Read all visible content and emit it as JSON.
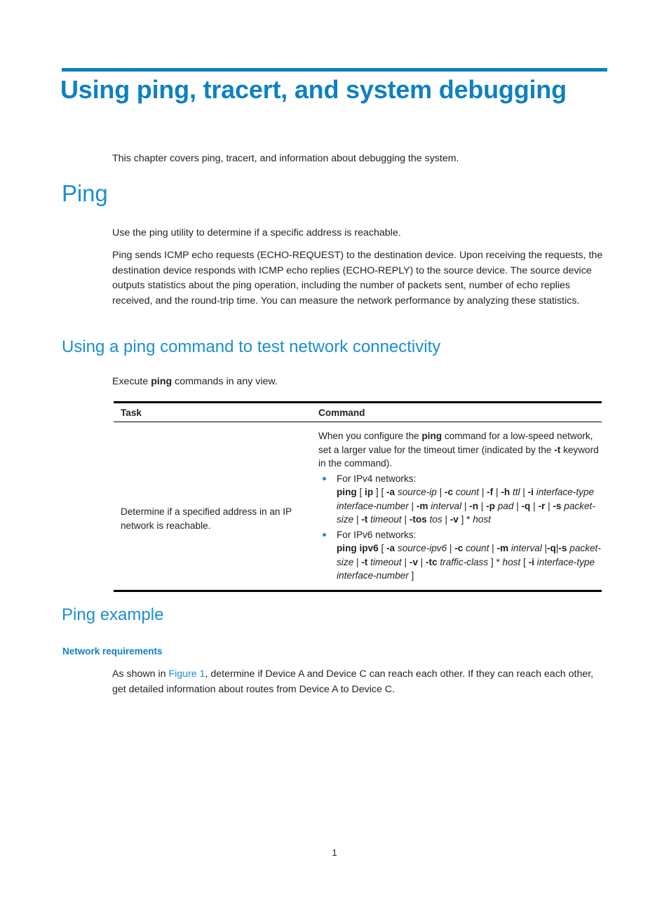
{
  "document": {
    "chapter_title": "Using ping, tracert, and system debugging",
    "intro_paragraph": "This chapter covers ping, tracert, and information about debugging the system.",
    "page_number": "1",
    "accent_color": "#0e81c0",
    "heading_color": "#1b8fcf",
    "link_color": "#1b8fcf",
    "text_color": "#231f20"
  },
  "ping_section": {
    "heading": "Ping",
    "paragraph_1": "Use the ping utility to determine if a specific address is reachable.",
    "paragraph_2": "Ping sends ICMP echo requests (ECHO-REQUEST) to the destination device. Upon receiving the requests, the destination device responds with ICMP echo replies (ECHO-REPLY) to the source device. The source device outputs statistics about the ping operation, including the number of packets sent, number of echo replies received, and the round-trip time. You can measure the network performance by analyzing these statistics."
  },
  "ping_command_section": {
    "heading": "Using a ping command to test network connectivity",
    "lead_in": {
      "prefix": "Execute ",
      "bold": "ping",
      "suffix": " commands in any view."
    },
    "table": {
      "headers": {
        "task": "Task",
        "command": "Command"
      },
      "row": {
        "task": "Determine if a specified address in an IP network is reachable.",
        "command_intro": {
          "part_1": "When you configure the ",
          "bold_1": "ping",
          "part_2": " command for a low-speed network, set a larger value for the timeout timer (indicated by the ",
          "bold_2": "-t",
          "part_3": " keyword in the command)."
        },
        "bullets": [
          {
            "label": "For IPv4 networks:",
            "syntax_tokens": [
              {
                "t": "ping",
                "s": "b"
              },
              {
                "t": " [ ",
                "s": "n"
              },
              {
                "t": "ip",
                "s": "b"
              },
              {
                "t": " ] [ ",
                "s": "n"
              },
              {
                "t": "-a",
                "s": "b"
              },
              {
                "t": " ",
                "s": "n"
              },
              {
                "t": "source-ip",
                "s": "i"
              },
              {
                "t": " | ",
                "s": "n"
              },
              {
                "t": "-c",
                "s": "b"
              },
              {
                "t": " ",
                "s": "n"
              },
              {
                "t": "count",
                "s": "i"
              },
              {
                "t": " | ",
                "s": "n"
              },
              {
                "t": "-f",
                "s": "b"
              },
              {
                "t": " | ",
                "s": "n"
              },
              {
                "t": "-h",
                "s": "b"
              },
              {
                "t": " ",
                "s": "n"
              },
              {
                "t": "ttl",
                "s": "i"
              },
              {
                "t": " | ",
                "s": "n"
              },
              {
                "t": "-i",
                "s": "b"
              },
              {
                "t": " ",
                "s": "n"
              },
              {
                "t": "interface-type interface-number",
                "s": "i"
              },
              {
                "t": " | ",
                "s": "n"
              },
              {
                "t": "-m",
                "s": "b"
              },
              {
                "t": " ",
                "s": "n"
              },
              {
                "t": "interval",
                "s": "i"
              },
              {
                "t": " | ",
                "s": "n"
              },
              {
                "t": "-n",
                "s": "b"
              },
              {
                "t": " | ",
                "s": "n"
              },
              {
                "t": "-p",
                "s": "b"
              },
              {
                "t": " ",
                "s": "n"
              },
              {
                "t": "pad",
                "s": "i"
              },
              {
                "t": " | ",
                "s": "n"
              },
              {
                "t": "-q",
                "s": "b"
              },
              {
                "t": " | ",
                "s": "n"
              },
              {
                "t": "-r",
                "s": "b"
              },
              {
                "t": " | ",
                "s": "n"
              },
              {
                "t": "-s",
                "s": "b"
              },
              {
                "t": " ",
                "s": "n"
              },
              {
                "t": "packet-size",
                "s": "i"
              },
              {
                "t": " | ",
                "s": "n"
              },
              {
                "t": "-t",
                "s": "b"
              },
              {
                "t": " ",
                "s": "n"
              },
              {
                "t": "timeout",
                "s": "i"
              },
              {
                "t": " | ",
                "s": "n"
              },
              {
                "t": "-tos",
                "s": "b"
              },
              {
                "t": " ",
                "s": "n"
              },
              {
                "t": "tos",
                "s": "i"
              },
              {
                "t": " | ",
                "s": "n"
              },
              {
                "t": "-v",
                "s": "b"
              },
              {
                "t": " ] * ",
                "s": "n"
              },
              {
                "t": "host",
                "s": "i"
              }
            ]
          },
          {
            "label": "For IPv6 networks:",
            "syntax_tokens": [
              {
                "t": "ping ipv6",
                "s": "b"
              },
              {
                "t": " [ ",
                "s": "n"
              },
              {
                "t": "-a",
                "s": "b"
              },
              {
                "t": " ",
                "s": "n"
              },
              {
                "t": "source-ipv6",
                "s": "i"
              },
              {
                "t": " | ",
                "s": "n"
              },
              {
                "t": "-c",
                "s": "b"
              },
              {
                "t": " ",
                "s": "n"
              },
              {
                "t": "count",
                "s": "i"
              },
              {
                "t": " | ",
                "s": "n"
              },
              {
                "t": "-m",
                "s": "b"
              },
              {
                "t": " ",
                "s": "n"
              },
              {
                "t": "interval",
                "s": "i"
              },
              {
                "t": " |",
                "s": "n"
              },
              {
                "t": "-q",
                "s": "b"
              },
              {
                "t": "|",
                "s": "n"
              },
              {
                "t": "-s",
                "s": "b"
              },
              {
                "t": " ",
                "s": "n"
              },
              {
                "t": "packet-size",
                "s": "i"
              },
              {
                "t": " | ",
                "s": "n"
              },
              {
                "t": "-t",
                "s": "b"
              },
              {
                "t": " ",
                "s": "n"
              },
              {
                "t": "timeout",
                "s": "i"
              },
              {
                "t": " | ",
                "s": "n"
              },
              {
                "t": "-v",
                "s": "b"
              },
              {
                "t": " | ",
                "s": "n"
              },
              {
                "t": "-tc",
                "s": "b"
              },
              {
                "t": " ",
                "s": "n"
              },
              {
                "t": "traffic-class",
                "s": "i"
              },
              {
                "t": " ] * ",
                "s": "n"
              },
              {
                "t": "host",
                "s": "i"
              },
              {
                "t": " [ ",
                "s": "n"
              },
              {
                "t": "-i",
                "s": "b"
              },
              {
                "t": " ",
                "s": "n"
              },
              {
                "t": "interface-type interface-number",
                "s": "i"
              },
              {
                "t": " ]",
                "s": "n"
              }
            ]
          }
        ]
      }
    }
  },
  "ping_example_section": {
    "heading": "Ping example",
    "subheading": "Network requirements",
    "paragraph": {
      "prefix": "As shown in ",
      "link": "Figure 1",
      "suffix": ", determine if Device A and Device C can reach each other. If they can reach each other, get detailed information about routes from Device A to Device C."
    }
  }
}
